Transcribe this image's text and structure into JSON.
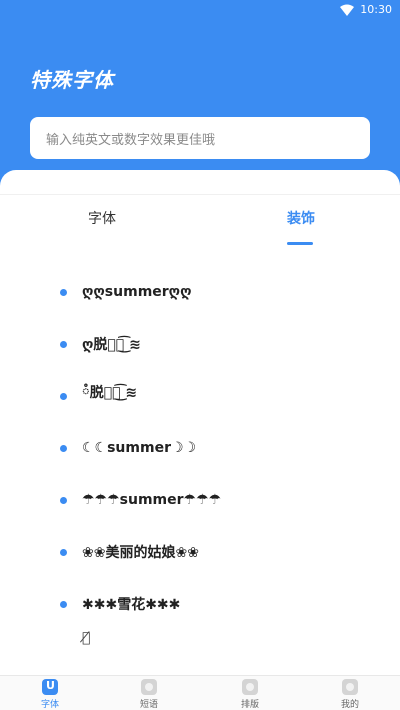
{
  "status_bar": {
    "time": "10:30"
  },
  "header": {
    "title": "特殊字体"
  },
  "search": {
    "placeholder": "输入纯英文或数字效果更佳哦"
  },
  "tabs": [
    {
      "label": "字体",
      "active": false
    },
    {
      "label": "装饰",
      "active": true
    }
  ],
  "list": [
    "ღღsummerღღ",
    "ღ脱ྀི͜͡ ≋",
    "ཾ脱ྀི͜͡ ≋",
    "☾☾summer☽☽",
    "☂☂☂summer☂☂☂",
    "❀❀美丽的姑娘❀❀",
    "✱✱✱雪花✱✱✱",
    "ཾ̸"
  ],
  "bottom_nav": [
    {
      "label": "字体",
      "active": true
    },
    {
      "label": "短语",
      "active": false
    },
    {
      "label": "排版",
      "active": false
    },
    {
      "label": "我的",
      "active": false
    }
  ],
  "colors": {
    "accent": "#3b8cf2",
    "header_bg": "#3b8cf2"
  }
}
